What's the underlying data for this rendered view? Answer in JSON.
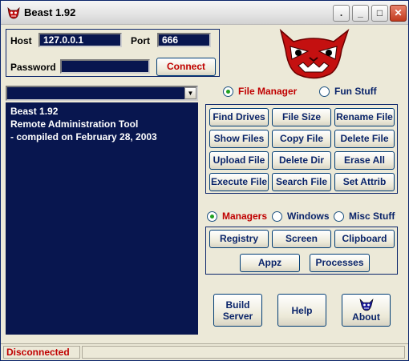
{
  "window": {
    "title": "Beast 1.92",
    "controls": {
      "help": ".",
      "minimize": "_",
      "maximize": "□",
      "close": "✕"
    }
  },
  "connection": {
    "host_label": "Host",
    "host_value": "127.0.0.1",
    "port_label": "Port",
    "port_value": "666",
    "password_label": "Password",
    "password_value": "",
    "connect_label": "Connect"
  },
  "combo": {
    "selected": ""
  },
  "console": {
    "lines": [
      "Beast 1.92",
      "Remote Administration Tool",
      "",
      "- compiled on February 28, 2003"
    ]
  },
  "section_radios": [
    {
      "label": "File Manager",
      "selected": true
    },
    {
      "label": "Fun Stuff",
      "selected": false
    }
  ],
  "file_buttons": [
    "Find Drives",
    "File Size",
    "Rename File",
    "Show Files",
    "Copy File",
    "Delete File",
    "Upload File",
    "Delete Dir",
    "Erase All",
    "Execute File",
    "Search File",
    "Set Attrib"
  ],
  "manager_radios": [
    {
      "label": "Managers",
      "selected": true
    },
    {
      "label": "Windows",
      "selected": false
    },
    {
      "label": "Misc Stuff",
      "selected": false
    }
  ],
  "manager_buttons": [
    "Registry",
    "Screen",
    "Clipboard",
    "Appz",
    "Processes"
  ],
  "bottom_buttons": {
    "build_line1": "Build",
    "build_line2": "Server",
    "help": "Help",
    "about": "About"
  },
  "status": {
    "text": "Disconnected",
    "text_color": "#c00000"
  },
  "colors": {
    "field_bg": "#08164f",
    "accent": "#0a246a",
    "logo": "#c41010"
  }
}
